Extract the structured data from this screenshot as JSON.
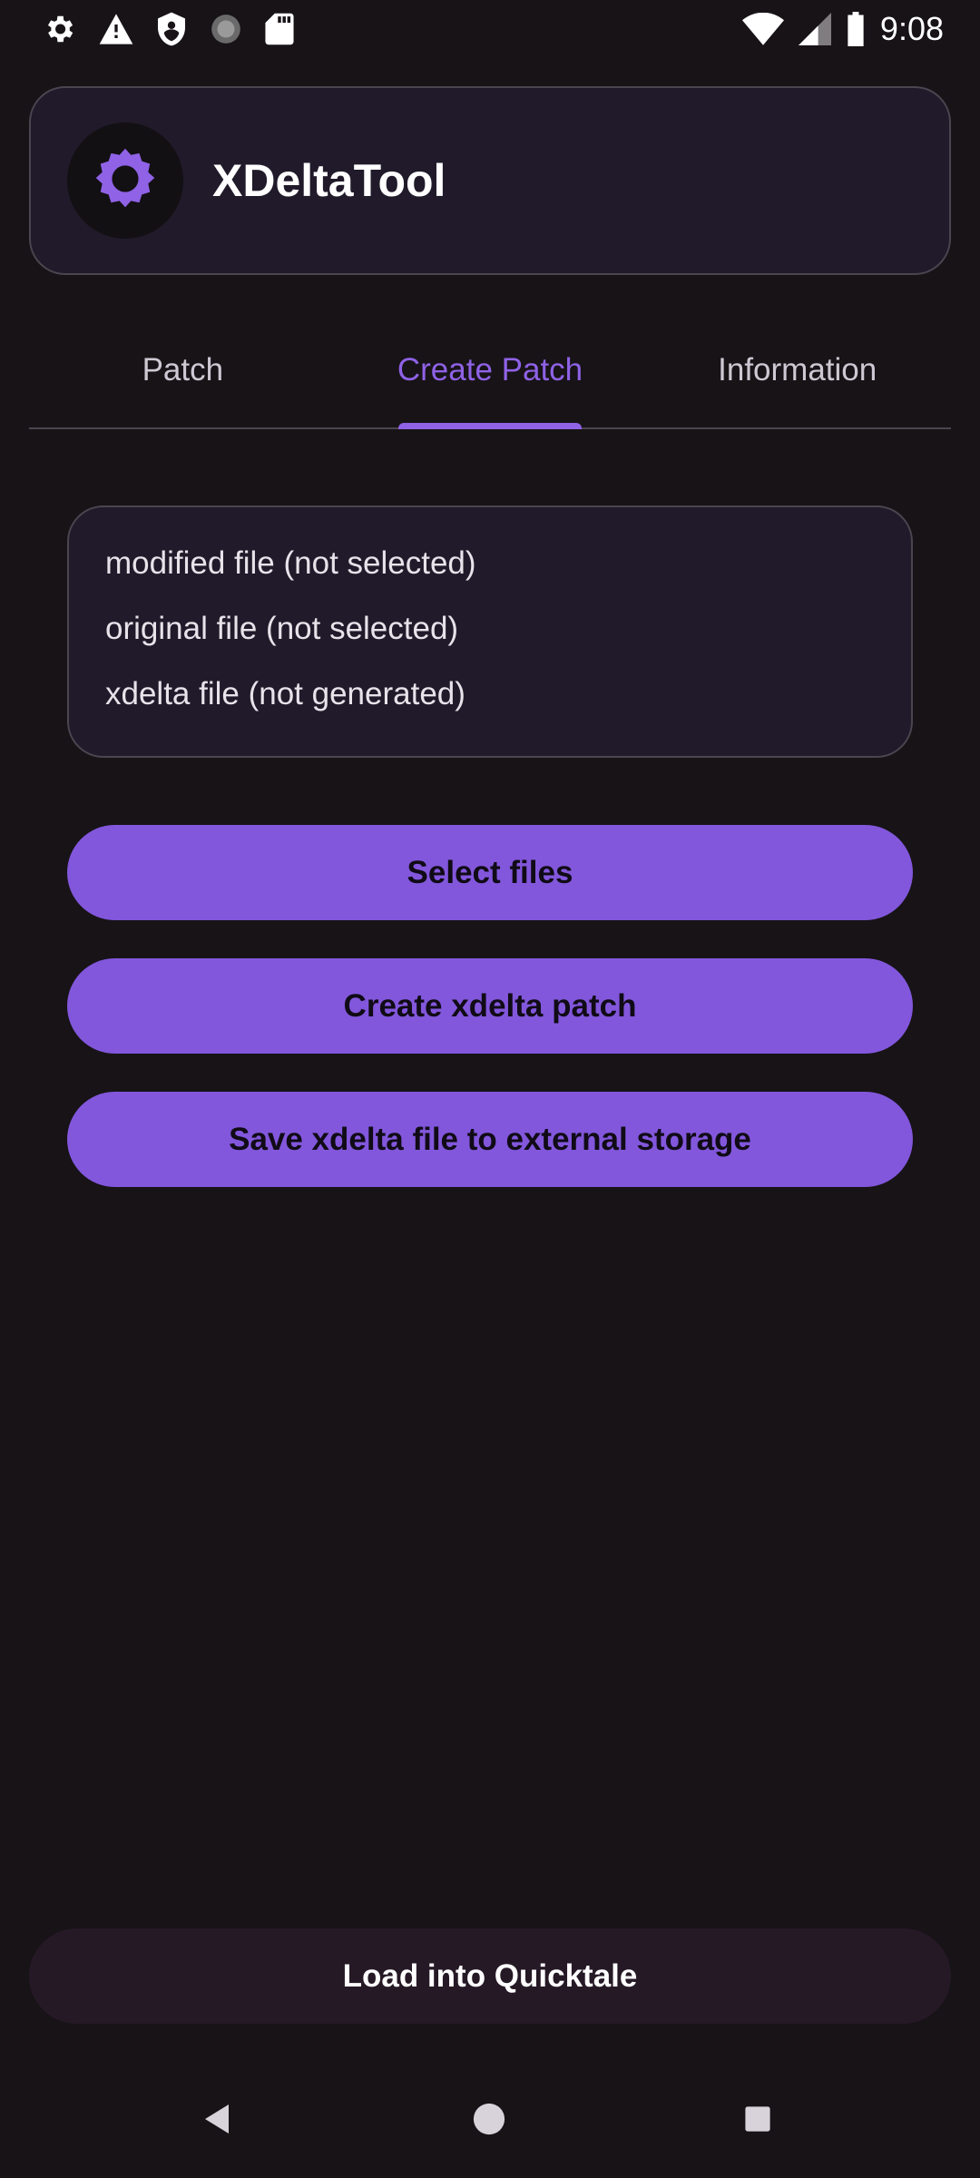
{
  "status_bar": {
    "time": "9:08",
    "left_icons": [
      "gear-icon",
      "warning-icon",
      "shield-icon",
      "loading-icon",
      "sd-card-icon"
    ],
    "right_icons": [
      "wifi-icon",
      "signal-icon",
      "battery-icon"
    ]
  },
  "header": {
    "title": "XDeltaTool",
    "logo_icon": "gear-icon"
  },
  "tabs": [
    {
      "label": "Patch",
      "active": false
    },
    {
      "label": "Create Patch",
      "active": true
    },
    {
      "label": "Information",
      "active": false
    }
  ],
  "file_status": {
    "lines": [
      "modified file (not selected)",
      "original file (not selected)",
      "xdelta file (not generated)"
    ]
  },
  "actions": {
    "select_files": "Select files",
    "create_patch": "Create xdelta patch",
    "save_file": "Save xdelta file to external storage"
  },
  "footer": {
    "load_label": "Load into Quicktale"
  },
  "colors": {
    "accent": "#8f62e6",
    "button": "#8257dc",
    "background": "#171317",
    "card": "#201a2a"
  }
}
